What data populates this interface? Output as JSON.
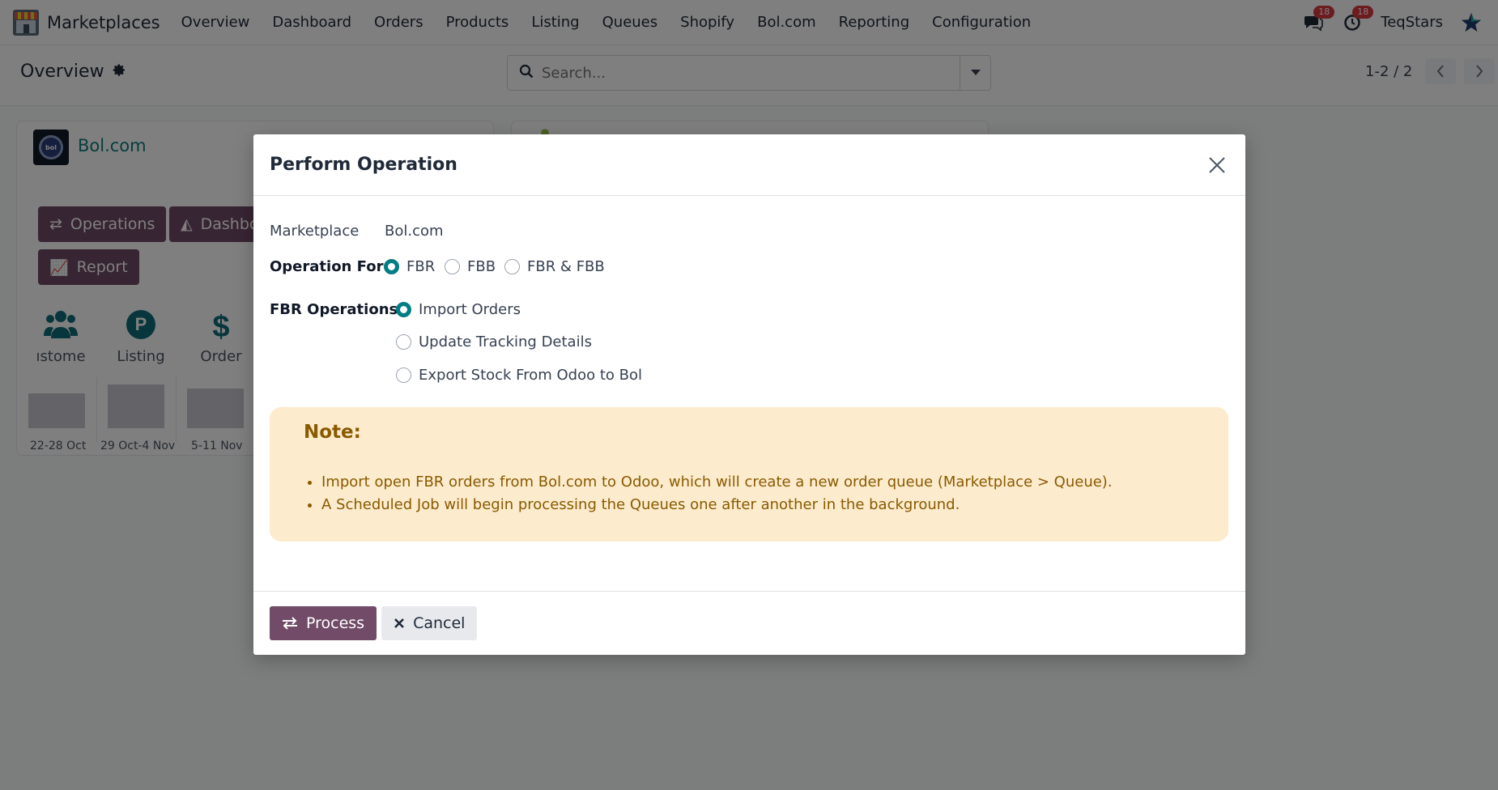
{
  "navbar": {
    "app_name": "Marketplaces",
    "menu": [
      "Overview",
      "Dashboard",
      "Orders",
      "Products",
      "Listing",
      "Queues",
      "Shopify",
      "Bol.com",
      "Reporting",
      "Configuration"
    ],
    "messages_count": "18",
    "activities_count": "18",
    "company": "TeqStars"
  },
  "control_panel": {
    "breadcrumb": "Overview",
    "search_placeholder": "Search...",
    "pager": "1-2 / 2"
  },
  "background": {
    "card_title": "Bol.com",
    "buttons": {
      "operations": "Operations",
      "dashboard": "Dashbo",
      "report": "Report"
    },
    "stats": [
      "ıstome",
      "Listing",
      "Order"
    ],
    "weeks": [
      "22-28 Oct",
      "29 Oct-4 Nov",
      "5-11 Nov"
    ]
  },
  "modal": {
    "title": "Perform Operation",
    "marketplace_label": "Marketplace",
    "marketplace_value": "Bol.com",
    "operation_for_label": "Operation For",
    "operation_for_options": [
      "FBR",
      "FBB",
      "FBR & FBB"
    ],
    "operation_for_selected": "FBR",
    "fbr_operations_label": "FBR Operations",
    "fbr_operations_options": [
      "Import Orders",
      "Update Tracking Details",
      "Export Stock From Odoo to Bol"
    ],
    "fbr_operations_selected": "Import Orders",
    "note": {
      "title": "Note:",
      "items": [
        "Import open FBR orders from Bol.com to Odoo, which will create a new order queue (Marketplace > Queue).",
        "A Scheduled Job will begin processing the Queues one after another in the background."
      ]
    },
    "footer": {
      "process": "Process",
      "cancel": "Cancel"
    }
  },
  "colors": {
    "brand": "#714b67",
    "accent": "#017e84",
    "note_bg": "#fcebcc",
    "note_text": "#8a5a00",
    "badge": "#d9363e"
  }
}
